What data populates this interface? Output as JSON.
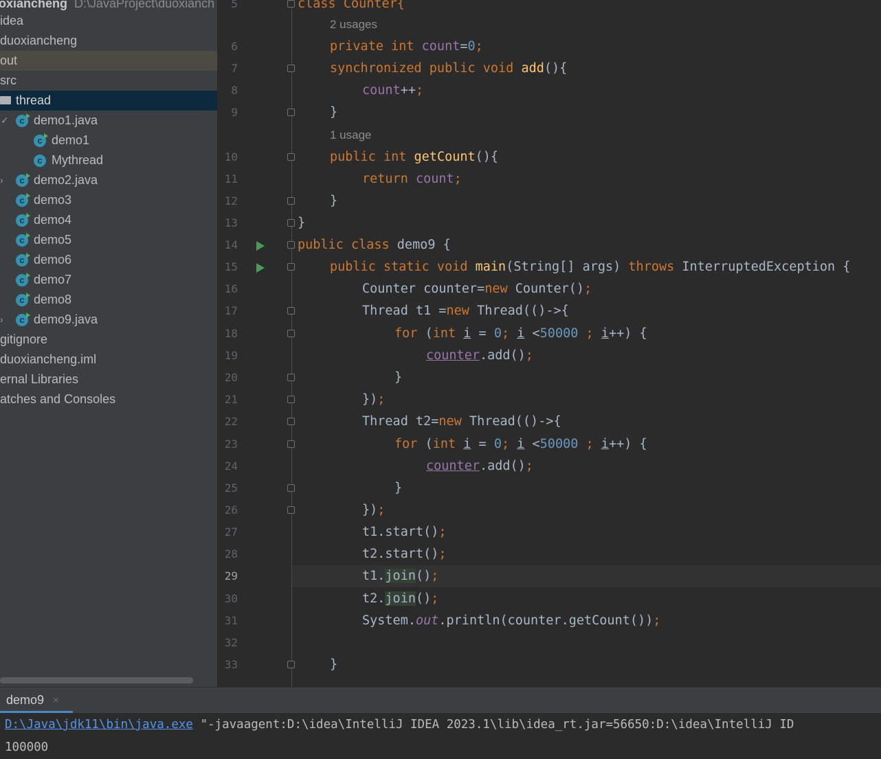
{
  "project_tree": {
    "root": {
      "name": "oxiancheng",
      "path": "D:\\JavaProject\\duoxianch"
    },
    "items": [
      {
        "label": "idea"
      },
      {
        "label": "duoxiancheng"
      },
      {
        "label": "out"
      },
      {
        "label": "src"
      },
      {
        "label": "thread"
      },
      {
        "label": "demo1.java"
      },
      {
        "label": "demo1"
      },
      {
        "label": "Mythread"
      },
      {
        "label": "demo2.java"
      },
      {
        "label": "demo3"
      },
      {
        "label": "demo4"
      },
      {
        "label": "demo5"
      },
      {
        "label": "demo6"
      },
      {
        "label": "demo7"
      },
      {
        "label": "demo8"
      },
      {
        "label": "demo9.java"
      },
      {
        "label": "gitignore"
      },
      {
        "label": "duoxiancheng.iml"
      },
      {
        "label": "ernal Libraries"
      },
      {
        "label": "atches and Consoles"
      }
    ]
  },
  "editor": {
    "line_numbers": [
      "5",
      "6",
      "7",
      "8",
      "9",
      "10",
      "11",
      "12",
      "13",
      "14",
      "15",
      "16",
      "17",
      "18",
      "19",
      "20",
      "21",
      "22",
      "23",
      "24",
      "25",
      "26",
      "27",
      "28",
      "29",
      "30",
      "31",
      "32",
      "33"
    ],
    "active_line": "29",
    "hints": {
      "usages_2": "2 usages",
      "usages_1": "1 usage"
    },
    "code": {
      "l5": "class Counter{",
      "l6_kw": "private int ",
      "l6_var": "count",
      "l6_eq": "=",
      "l6_num": "0",
      "l6_semi": ";",
      "l7_kw": "synchronized public void ",
      "l7_fn": "add",
      "l7_rest": "(){",
      "l8_var": "count",
      "l8_op": "++",
      "l8_semi": ";",
      "l9": "}",
      "l10_kw": "public int ",
      "l10_fn": "getCount",
      "l10_rest": "(){",
      "l11_kw": "return ",
      "l11_var": "count",
      "l11_semi": ";",
      "l12": "}",
      "l13": "}",
      "l14_kw": "public class ",
      "l14_rest": "demo9 {",
      "l15_kw": "public static void ",
      "l15_fn": "main",
      "l15_mid": "(String[] args) ",
      "l15_kw2": "throws ",
      "l15_rest": "InterruptedException {",
      "l16_a": "Counter counter=",
      "l16_kw": "new ",
      "l16_b": "Counter()",
      "l16_semi": ";",
      "l17_a": "Thread t1 =",
      "l17_kw": "new ",
      "l17_b": "Thread(()->{",
      "l18_kw": "for ",
      "l18_p": "(",
      "l18_kw2": "int ",
      "l18_i": "i",
      "l18_eq": " = ",
      "l18_n0": "0",
      "l18_s1": "; ",
      "l18_i2": "i",
      "l18_lt": " <",
      "l18_n": "50000",
      "l18_s2": " ; ",
      "l18_i3": "i",
      "l18_end": "++) {",
      "l19_var": "counter",
      "l19_rest": ".add()",
      "l19_semi": ";",
      "l20": "}",
      "l21_a": "})",
      "l21_semi": ";",
      "l22_a": "Thread t2=",
      "l22_kw": "new ",
      "l22_b": "Thread(()->{",
      "l23_kw": "for ",
      "l23_p": "(",
      "l23_kw2": "int ",
      "l23_i": "i",
      "l23_eq": " = ",
      "l23_n0": "0",
      "l23_s1": "; ",
      "l23_i2": "i",
      "l23_lt": " <",
      "l23_n": "50000",
      "l23_s2": " ; ",
      "l23_i3": "i",
      "l23_end": "++) {",
      "l24_var": "counter",
      "l24_rest": ".add()",
      "l24_semi": ";",
      "l25": "}",
      "l26_a": "})",
      "l26_semi": ";",
      "l27_a": "t1.start()",
      "l27_semi": ";",
      "l28_a": "t2.start()",
      "l28_semi": ";",
      "l29_a": "t1.",
      "l29_hl": "join",
      "l29_b": "()",
      "l29_semi": ";",
      "l30_a": "t2.",
      "l30_hl": "join",
      "l30_b": "()",
      "l30_semi": ";",
      "l31_a": "System.",
      "l31_out": "out",
      "l31_b": ".println(counter.getCount())",
      "l31_semi": ";",
      "l33": "}"
    }
  },
  "run_panel": {
    "tab_label": "demo9",
    "tab_close": "×",
    "command_link": "D:\\Java\\jdk11\\bin\\java.exe",
    "command_rest": " \"-javaagent:D:\\idea\\IntelliJ IDEA 2023.1\\lib\\idea_rt.jar=56650:D:\\idea\\IntelliJ ID",
    "output": "100000"
  },
  "colors": {
    "keyword": "#cc7832",
    "field": "#9876aa",
    "number": "#6897bb",
    "method": "#ffc66d",
    "text": "#a9b7c6",
    "selection": "#0d293e"
  }
}
